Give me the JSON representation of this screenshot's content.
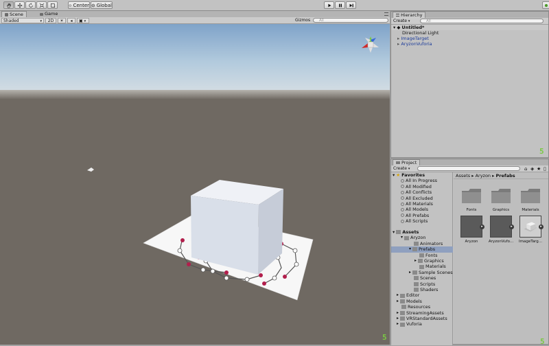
{
  "toolbar": {
    "pivot_label": "Center",
    "space_label": "Global"
  },
  "scene": {
    "tab_scene": "Scene",
    "tab_game": "Game",
    "shading_mode": "Shaded",
    "mode_2d": "2D",
    "gizmos_label": "Gizmos",
    "search_placeholder": "All"
  },
  "hierarchy": {
    "title": "Hierarchy",
    "create_label": "Create",
    "search_placeholder": "All",
    "scene_name": "Untitled*",
    "items": [
      "Directional Light",
      "ImageTarget",
      "AryzonVuforia"
    ]
  },
  "project": {
    "title": "Project",
    "create_label": "Create",
    "favorites_label": "Favorites",
    "favorites": [
      "All In Progress",
      "All Modified",
      "All Conflicts",
      "All Excluded",
      "All Materials",
      "All Models",
      "All Prefabs",
      "All Scripts"
    ],
    "assets_label": "Assets",
    "tree": [
      "Aryzon",
      "Animators",
      "Prefabs",
      "Fonts",
      "Graphics",
      "Materials",
      "Sample Scenes",
      "Scenes",
      "Scripts",
      "Shaders",
      "Editor",
      "Models",
      "Resources",
      "StreamingAssets",
      "VRStandardAssets",
      "Vuforia"
    ],
    "breadcrumb": [
      "Assets",
      "Aryzon",
      "Prefabs"
    ],
    "folders": [
      "Fonts",
      "Graphics",
      "Materials"
    ],
    "prefabs": [
      "Aryzon",
      "AryzonVufo...",
      "ImageTarg..."
    ]
  },
  "colors": {
    "sky_top": "#7fa3c9",
    "ground": "#6f6962",
    "selection": "#8fa0bf",
    "accent_green": "#7ac943"
  }
}
